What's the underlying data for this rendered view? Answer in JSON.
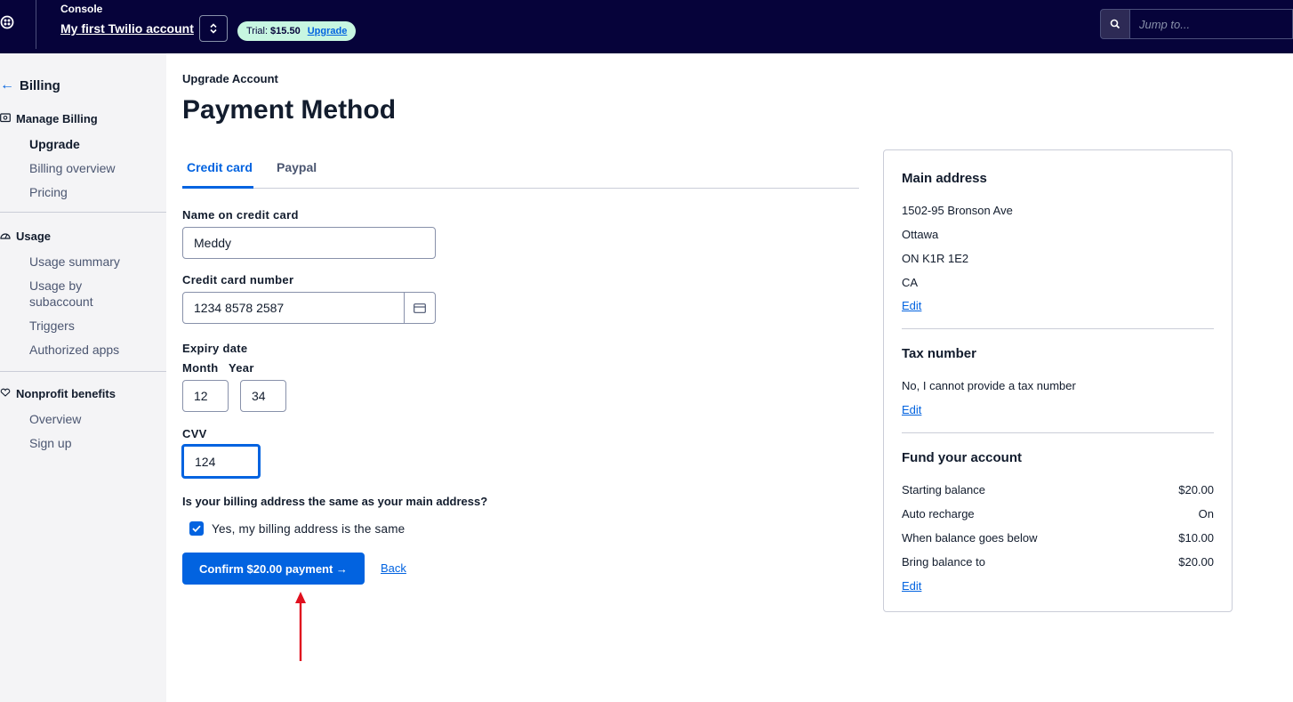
{
  "header": {
    "console_label": "Console",
    "account_name": "My first Twilio account",
    "trial_label": "Trial:",
    "trial_amount": "$15.50",
    "upgrade_label": "Upgrade",
    "search_placeholder": "Jump to..."
  },
  "sidebar": {
    "back_label": "Billing",
    "sections": [
      {
        "title": "Manage Billing",
        "icon": "billing-icon",
        "items": [
          "Upgrade",
          "Billing overview",
          "Pricing"
        ]
      },
      {
        "title": "Usage",
        "icon": "gauge-icon",
        "items": [
          "Usage summary",
          "Usage by",
          "subaccount",
          "Triggers",
          "Authorized apps"
        ]
      },
      {
        "title": "Nonprofit benefits",
        "icon": "heart-hand-icon",
        "items": [
          "Overview",
          "Sign up"
        ]
      }
    ]
  },
  "main": {
    "breadcrumb": "Upgrade Account",
    "title": "Payment Method",
    "tabs": [
      "Credit card",
      "Paypal"
    ],
    "form": {
      "name_label": "Name on credit card",
      "name_value": "Meddy",
      "number_label": "Credit card number",
      "number_value": "1234 8578 2587",
      "expiry_label": "Expiry date",
      "month_label": "Month",
      "year_label": "Year",
      "month_value": "12",
      "year_value": "34",
      "cvv_label": "CVV",
      "cvv_value": "124",
      "address_question": "Is your billing address the same as your main address?",
      "same_address_label": "Yes, my billing address is the same",
      "same_address_checked": true,
      "confirm_label": "Confirm $20.00 payment →",
      "back_label": "Back"
    }
  },
  "summary": {
    "main_address_title": "Main address",
    "address_lines": [
      "1502-95 Bronson Ave",
      "Ottawa",
      "ON K1R 1E2",
      "CA"
    ],
    "edit_label": "Edit",
    "tax_title": "Tax number",
    "tax_text": "No, I cannot provide a tax number",
    "fund_title": "Fund your account",
    "fund_rows": [
      {
        "label": "Starting balance",
        "value": "$20.00"
      },
      {
        "label": "Auto recharge",
        "value": "On"
      },
      {
        "label": "When balance goes below",
        "value": "$10.00"
      },
      {
        "label": "Bring balance to",
        "value": "$20.00"
      }
    ]
  },
  "colors": {
    "topbar": "#06033a",
    "accent": "#0263e0",
    "annotation_arrow": "#e0101e"
  }
}
